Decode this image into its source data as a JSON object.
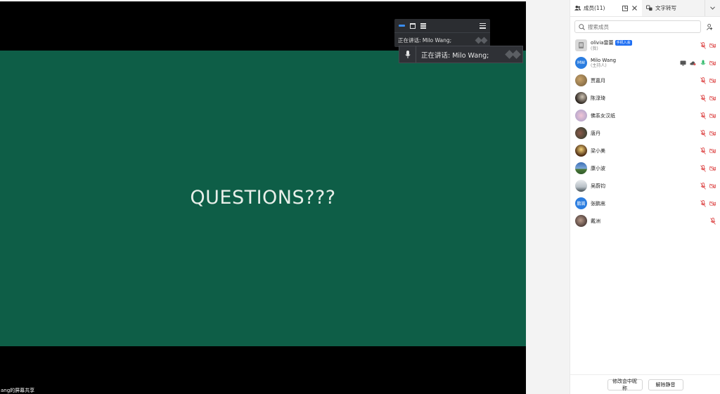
{
  "stage": {
    "slide_text": "QUESTIONS???",
    "share_caption": "ang的屏幕共享",
    "slide_color": "#0e5e47"
  },
  "float_bar": {
    "speaking_label": "正在讲话:",
    "speaking_name": "Milo Wang;"
  },
  "speak_popup": {
    "text": "正在讲话:  Milo Wang;"
  },
  "panel": {
    "tabs": {
      "members": "成员(11)",
      "transcribe": "文字转写"
    },
    "search": {
      "placeholder": "搜索成员"
    },
    "members": [
      {
        "name": "olivia雷蕾",
        "sub": "(我)",
        "badge": "手机入会",
        "avatar_type": "gray",
        "icons": [
          "mic-muted-icon",
          "video-off-icon"
        ]
      },
      {
        "name": "Milo Wang",
        "sub": "(主持人)",
        "initials": "MW",
        "avatar_type": "blue",
        "icons": [
          "screen-share-icon",
          "cloud-record-icon",
          "mic-active-icon",
          "video-off-icon"
        ]
      },
      {
        "name": "贾嘉月",
        "avatar_type": "photo1",
        "icons": [
          "mic-muted-icon",
          "video-off-icon"
        ]
      },
      {
        "name": "陈渌琦",
        "avatar_type": "photo2",
        "icons": [
          "mic-muted-icon",
          "video-off-icon"
        ]
      },
      {
        "name": "佛系女汉纸",
        "avatar_type": "photo3",
        "icons": [
          "mic-muted-icon",
          "video-off-icon"
        ]
      },
      {
        "name": "唐丹",
        "avatar_type": "photo4",
        "icons": [
          "mic-muted-icon",
          "video-off-icon"
        ]
      },
      {
        "name": "梁小美",
        "avatar_type": "photo5",
        "icons": [
          "mic-muted-icon",
          "video-off-icon"
        ]
      },
      {
        "name": "康小波",
        "avatar_type": "photo6",
        "icons": [
          "mic-muted-icon",
          "video-off-icon"
        ]
      },
      {
        "name": "吴蔚钧",
        "avatar_type": "photo7",
        "icons": [
          "mic-muted-icon",
          "video-off-icon"
        ]
      },
      {
        "name": "张鹏嵩",
        "initials": "鹏嵩",
        "avatar_type": "blue",
        "icons": [
          "mic-muted-icon",
          "video-off-icon"
        ]
      },
      {
        "name": "戴洲",
        "avatar_type": "photo8",
        "icons": [
          "mic-muted-icon"
        ]
      }
    ],
    "footer": {
      "rename": "修改会中昵称",
      "unmute": "解除静音"
    }
  },
  "colors": {
    "accent": "#1f6ff3",
    "muted_red": "#e05656",
    "mic_green": "#2fb96a",
    "toolbar_bg": "#2b2d31"
  }
}
